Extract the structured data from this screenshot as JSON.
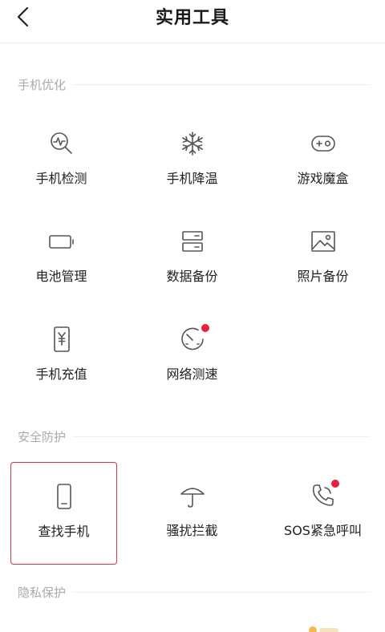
{
  "header": {
    "title": "实用工具",
    "back_icon": "chevron-left-icon"
  },
  "colors": {
    "accent": "#d4354c",
    "badge": "#e8203a",
    "icon_stroke": "#555555",
    "section_text": "#a9a9a9"
  },
  "sections": [
    {
      "label": "手机优化",
      "items": [
        {
          "label": "手机检测",
          "icon": "phone-check-icon"
        },
        {
          "label": "手机降温",
          "icon": "snowflake-icon"
        },
        {
          "label": "游戏魔盒",
          "icon": "gamepad-icon"
        },
        {
          "label": "电池管理",
          "icon": "battery-icon"
        },
        {
          "label": "数据备份",
          "icon": "data-backup-icon"
        },
        {
          "label": "照片备份",
          "icon": "photo-icon"
        },
        {
          "label": "手机充值",
          "icon": "recharge-icon"
        },
        {
          "label": "网络测速",
          "icon": "speedometer-icon",
          "badge": true
        }
      ]
    },
    {
      "label": "安全防护",
      "items": [
        {
          "label": "查找手机",
          "icon": "find-phone-icon",
          "selected": true
        },
        {
          "label": "骚扰拦截",
          "icon": "umbrella-icon"
        },
        {
          "label": "SOS紧急呼叫",
          "icon": "phone-call-icon",
          "badge": true
        }
      ]
    },
    {
      "label": "隐私保护",
      "items": []
    }
  ]
}
